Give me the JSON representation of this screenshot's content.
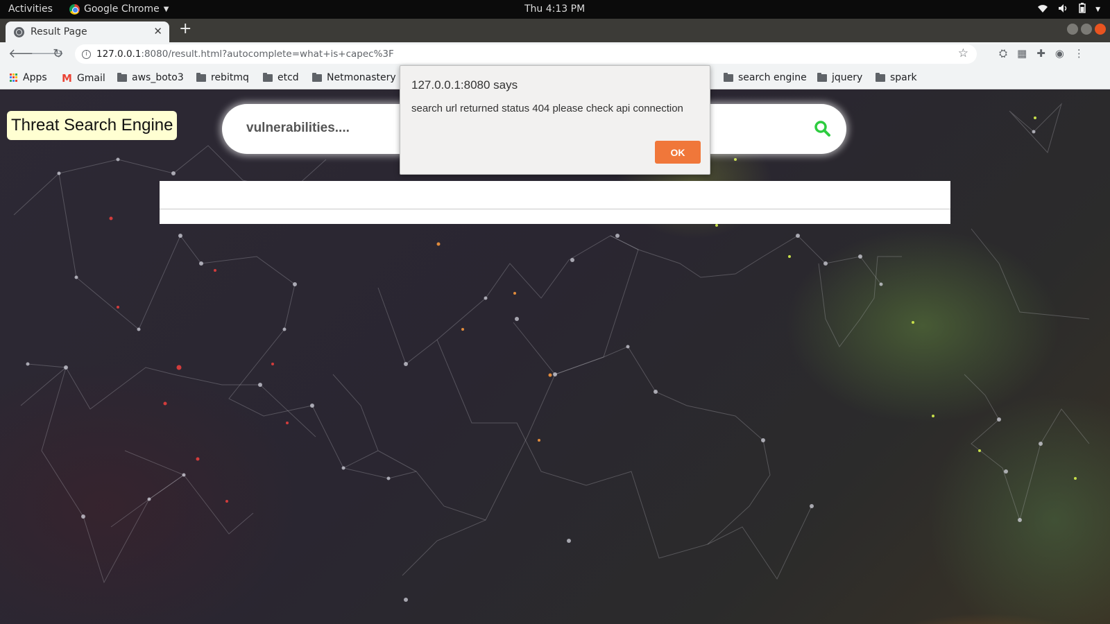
{
  "system_bar": {
    "activities": "Activities",
    "app_name": "Google Chrome",
    "clock": "Thu  4:13 PM",
    "tray_icons": [
      "wifi-icon",
      "volume-icon",
      "battery-icon",
      "power-menu-icon"
    ]
  },
  "browser": {
    "tab_title": "Result Page",
    "new_tab_label": "+",
    "address_host": "127.0.0.1",
    "address_rest": ":8080/result.html?autocomplete=what+is+capec%3F",
    "bookmarks": {
      "apps": "Apps",
      "gmail": "Gmail",
      "aws_boto3": "aws_boto3",
      "rebitmq": "rebitmq",
      "etcd": "etcd",
      "netmonastery": "Netmonastery",
      "search_engine": "search engine",
      "jquery": "jquery",
      "spark": "spark"
    }
  },
  "page": {
    "logo_text": "Threat Search Engine",
    "search_placeholder": "vulnerabilities...."
  },
  "alert": {
    "origin": "127.0.0.1:8080 says",
    "message": "search url returned status 404 please check api connection",
    "ok_label": "OK"
  },
  "colors": {
    "search_icon": "#2ecc40",
    "ok_button": "#f0773a",
    "logo_background": "#ffffd2"
  }
}
